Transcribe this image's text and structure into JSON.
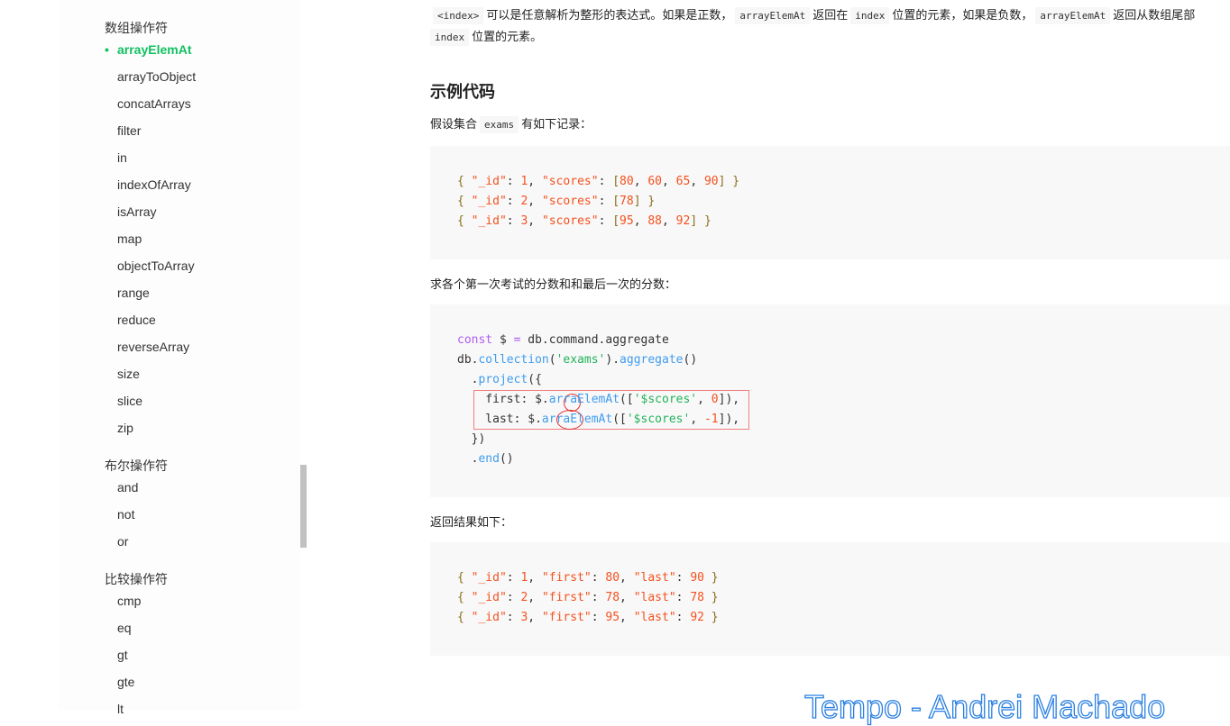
{
  "sidebar": {
    "array_group": "数组操作符",
    "array_items": [
      "arrayElemAt",
      "arrayToObject",
      "concatArrays",
      "filter",
      "in",
      "indexOfArray",
      "isArray",
      "map",
      "objectToArray",
      "range",
      "reduce",
      "reverseArray",
      "size",
      "slice",
      "zip"
    ],
    "active_item": "arrayElemAt",
    "bool_group": "布尔操作符",
    "bool_items": [
      "and",
      "not",
      "or"
    ],
    "cmp_group": "比较操作符",
    "cmp_items": [
      "cmp",
      "eq",
      "gt",
      "gte",
      "lt"
    ]
  },
  "colors": {
    "accent": "#10c060",
    "highlight_box": "#f08080"
  },
  "main": {
    "intro": {
      "c1": "<index>",
      "t1": "可以是任意解析为整形的表达式。如果是正数，",
      "c2": "arrayElemAt",
      "t2": "返回在",
      "c3": "index",
      "t3": "位置的元素，如果是负数，",
      "c4": "arrayElemAt",
      "t4": "返回从数组尾部",
      "c5": "index",
      "t5": "位置的元素。"
    },
    "heading": "示例代码",
    "p1": {
      "t1": "假设集合",
      "c1": "exams",
      "t2": "有如下记录："
    },
    "code1": [
      [
        [
          "{ ",
          "p"
        ],
        [
          "\"_id\"",
          "s"
        ],
        [
          ": ",
          "d"
        ],
        [
          "1",
          "o"
        ],
        [
          ", ",
          "d"
        ],
        [
          "\"scores\"",
          "s"
        ],
        [
          ": ",
          "d"
        ],
        [
          "[",
          "p"
        ],
        [
          "80",
          "o"
        ],
        [
          ", ",
          "d"
        ],
        [
          "60",
          "o"
        ],
        [
          ", ",
          "d"
        ],
        [
          "65",
          "o"
        ],
        [
          ", ",
          "d"
        ],
        [
          "90",
          "o"
        ],
        [
          "] }",
          "p"
        ]
      ],
      [
        [
          "{ ",
          "p"
        ],
        [
          "\"_id\"",
          "s"
        ],
        [
          ": ",
          "d"
        ],
        [
          "2",
          "o"
        ],
        [
          ", ",
          "d"
        ],
        [
          "\"scores\"",
          "s"
        ],
        [
          ": ",
          "d"
        ],
        [
          "[",
          "p"
        ],
        [
          "78",
          "o"
        ],
        [
          "] }",
          "p"
        ]
      ],
      [
        [
          "{ ",
          "p"
        ],
        [
          "\"_id\"",
          "s"
        ],
        [
          ": ",
          "d"
        ],
        [
          "3",
          "o"
        ],
        [
          ", ",
          "d"
        ],
        [
          "\"scores\"",
          "s"
        ],
        [
          ": ",
          "d"
        ],
        [
          "[",
          "p"
        ],
        [
          "95",
          "o"
        ],
        [
          ", ",
          "d"
        ],
        [
          "88",
          "o"
        ],
        [
          ", ",
          "d"
        ],
        [
          "92",
          "o"
        ],
        [
          "] }",
          "p"
        ]
      ]
    ],
    "p2": "求各个第一次考试的分数和和最后一次的分数：",
    "code2": [
      [
        [
          "const",
          "k"
        ],
        [
          " $ ",
          "d"
        ],
        [
          "=",
          "k"
        ],
        [
          " db.command.aggregate",
          "d"
        ]
      ],
      [
        [
          "db.",
          "d"
        ],
        [
          "collection",
          "f"
        ],
        [
          "(",
          "d"
        ],
        [
          "'exams'",
          "g"
        ],
        [
          ").",
          "d"
        ],
        [
          "aggregate",
          "f"
        ],
        [
          "()",
          "d"
        ]
      ],
      [
        [
          "  .",
          "d"
        ],
        [
          "project",
          "f"
        ],
        [
          "({",
          "d"
        ]
      ],
      [
        [
          "    first: $.",
          "d"
        ],
        [
          "arraElemAt",
          "f"
        ],
        [
          "([",
          "d"
        ],
        [
          "'$scores'",
          "g"
        ],
        [
          ", ",
          "d"
        ],
        [
          "0",
          "o"
        ],
        [
          "]),",
          "d"
        ]
      ],
      [
        [
          "    last: $.",
          "d"
        ],
        [
          "arraElemAt",
          "f"
        ],
        [
          "([",
          "d"
        ],
        [
          "'$scores'",
          "g"
        ],
        [
          ", ",
          "d"
        ],
        [
          "-1",
          "o"
        ],
        [
          "]),",
          "d"
        ]
      ],
      [
        [
          "  })",
          "d"
        ]
      ],
      [
        [
          "  .",
          "d"
        ],
        [
          "end",
          "f"
        ],
        [
          "()",
          "d"
        ]
      ]
    ],
    "p3": "返回结果如下：",
    "code3": [
      [
        [
          "{ ",
          "p"
        ],
        [
          "\"_id\"",
          "s"
        ],
        [
          ": ",
          "d"
        ],
        [
          "1",
          "o"
        ],
        [
          ", ",
          "d"
        ],
        [
          "\"first\"",
          "s"
        ],
        [
          ": ",
          "d"
        ],
        [
          "80",
          "o"
        ],
        [
          ", ",
          "d"
        ],
        [
          "\"last\"",
          "s"
        ],
        [
          ": ",
          "d"
        ],
        [
          "90",
          "o"
        ],
        [
          " }",
          "p"
        ]
      ],
      [
        [
          "{ ",
          "p"
        ],
        [
          "\"_id\"",
          "s"
        ],
        [
          ": ",
          "d"
        ],
        [
          "2",
          "o"
        ],
        [
          ", ",
          "d"
        ],
        [
          "\"first\"",
          "s"
        ],
        [
          ": ",
          "d"
        ],
        [
          "78",
          "o"
        ],
        [
          ", ",
          "d"
        ],
        [
          "\"last\"",
          "s"
        ],
        [
          ": ",
          "d"
        ],
        [
          "78",
          "o"
        ],
        [
          " }",
          "p"
        ]
      ],
      [
        [
          "{ ",
          "p"
        ],
        [
          "\"_id\"",
          "s"
        ],
        [
          ": ",
          "d"
        ],
        [
          "3",
          "o"
        ],
        [
          ", ",
          "d"
        ],
        [
          "\"first\"",
          "s"
        ],
        [
          ": ",
          "d"
        ],
        [
          "95",
          "o"
        ],
        [
          ", ",
          "d"
        ],
        [
          "\"last\"",
          "s"
        ],
        [
          ": ",
          "d"
        ],
        [
          "92",
          "o"
        ],
        [
          " }",
          "p"
        ]
      ]
    ]
  },
  "watermark": "Tempo - Andrei Machado"
}
